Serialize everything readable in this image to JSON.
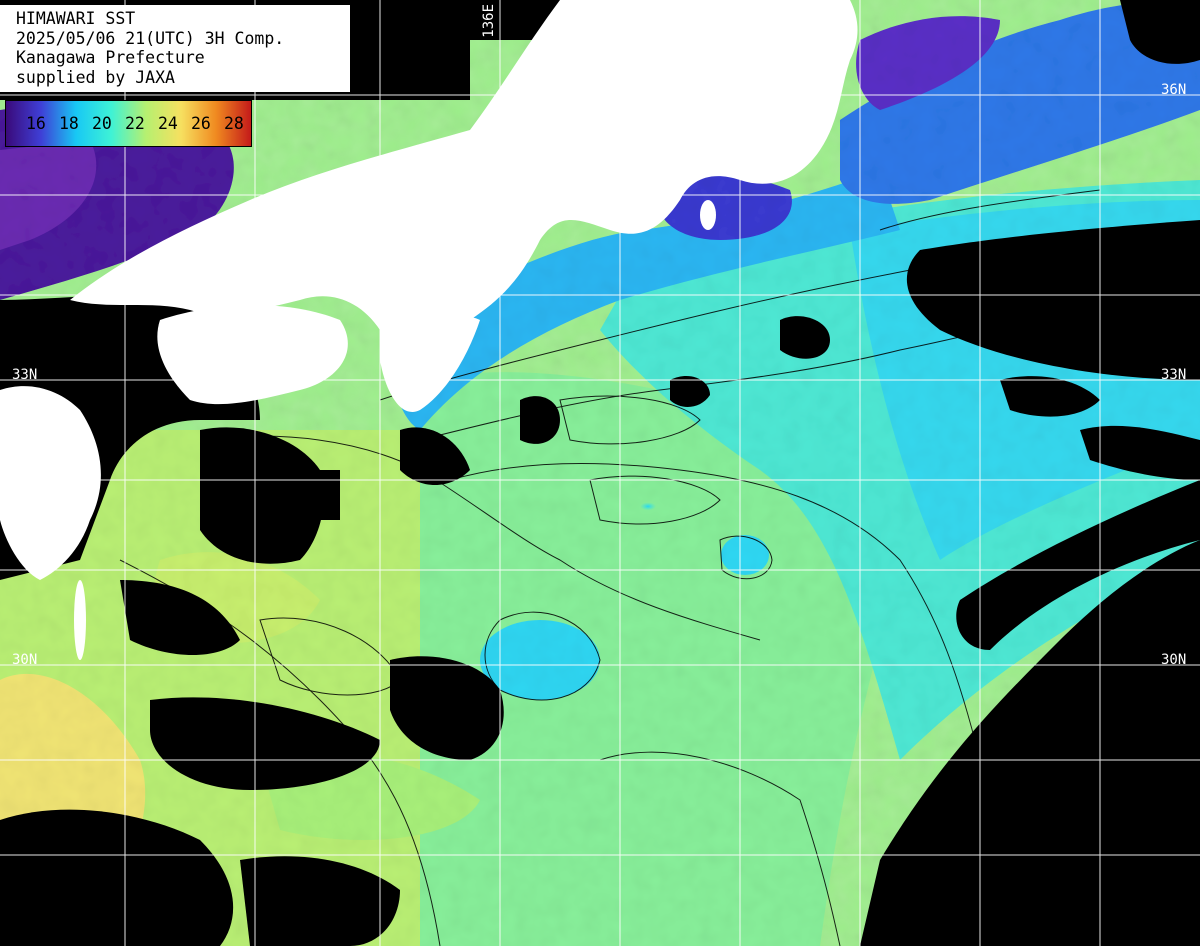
{
  "title": {
    "line1": "HIMAWARI SST",
    "line2": "2025/05/06 21(UTC) 3H Comp.",
    "line3": "Kanagawa Prefecture",
    "line4": "supplied by JAXA"
  },
  "color_scale": {
    "ticks": [
      "16",
      "18",
      "20",
      "22",
      "24",
      "26",
      "28"
    ],
    "colors": [
      "#3a0a7a",
      "#3f3fd6",
      "#18c8f4",
      "#3ef2d6",
      "#b6f070",
      "#f6e060",
      "#f08a20",
      "#c41a1a"
    ]
  },
  "grid": {
    "lat_labels": [
      "36N",
      "33N",
      "30N",
      "33N",
      "30N"
    ],
    "lon_labels": [
      "136E"
    ]
  },
  "colors": {
    "land": "#ffffff",
    "cloud": "#000000",
    "grid": "#ffffff",
    "contour": "#000000"
  }
}
